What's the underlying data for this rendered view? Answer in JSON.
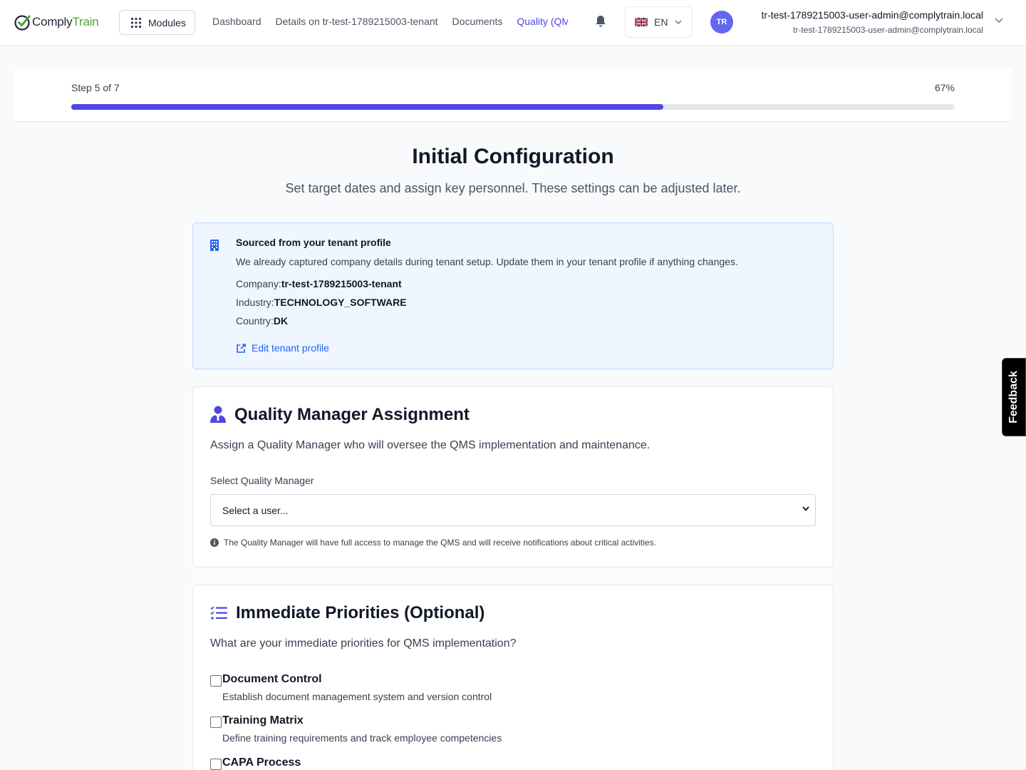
{
  "header": {
    "logo": {
      "part1": "Comply",
      "part2": "Train"
    },
    "modules_label": "Modules",
    "nav": [
      {
        "label": "Dashboard"
      },
      {
        "label": "Details on tr-test-1789215003-tenant"
      },
      {
        "label": "Documents"
      },
      {
        "label": "Quality (QMS)"
      }
    ],
    "language": "EN",
    "user": {
      "initials": "TR",
      "name": "tr-test-1789215003-user-admin@complytrain.local",
      "email": "tr-test-1789215003-user-admin@complytrain.local"
    }
  },
  "progress": {
    "step_label": "Step 5 of 7",
    "percent_label": "67%",
    "percent": 67
  },
  "page": {
    "title": "Initial Configuration",
    "subtitle": "Set target dates and assign key personnel. These settings can be adjusted later."
  },
  "tenant_info": {
    "title": "Sourced from your tenant profile",
    "description": "We already captured company details during tenant setup. Update them in your tenant profile if anything changes.",
    "company_label": "Company:",
    "company_value": "tr-test-1789215003-tenant",
    "industry_label": "Industry:",
    "industry_value": "TECHNOLOGY_SOFTWARE",
    "country_label": "Country:",
    "country_value": "DK",
    "edit_link": "Edit tenant profile"
  },
  "quality_manager": {
    "title": "Quality Manager Assignment",
    "description": "Assign a Quality Manager who will oversee the QMS implementation and maintenance.",
    "field_label": "Select Quality Manager",
    "selected_value": "Select a user...",
    "hint": "The Quality Manager will have full access to manage the QMS and will receive notifications about critical activities."
  },
  "priorities": {
    "title": "Immediate Priorities (Optional)",
    "description": "What are your immediate priorities for QMS implementation?",
    "items": [
      {
        "title": "Document Control",
        "desc": "Establish document management system and version control"
      },
      {
        "title": "Training Matrix",
        "desc": "Define training requirements and track employee competencies"
      },
      {
        "title": "CAPA Process",
        "desc": ""
      }
    ]
  },
  "feedback_label": "Feedback",
  "colors": {
    "accent": "#4f46e5",
    "brand_green": "#4ea13a",
    "info_bg": "#eff6ff",
    "link": "#2563eb"
  }
}
